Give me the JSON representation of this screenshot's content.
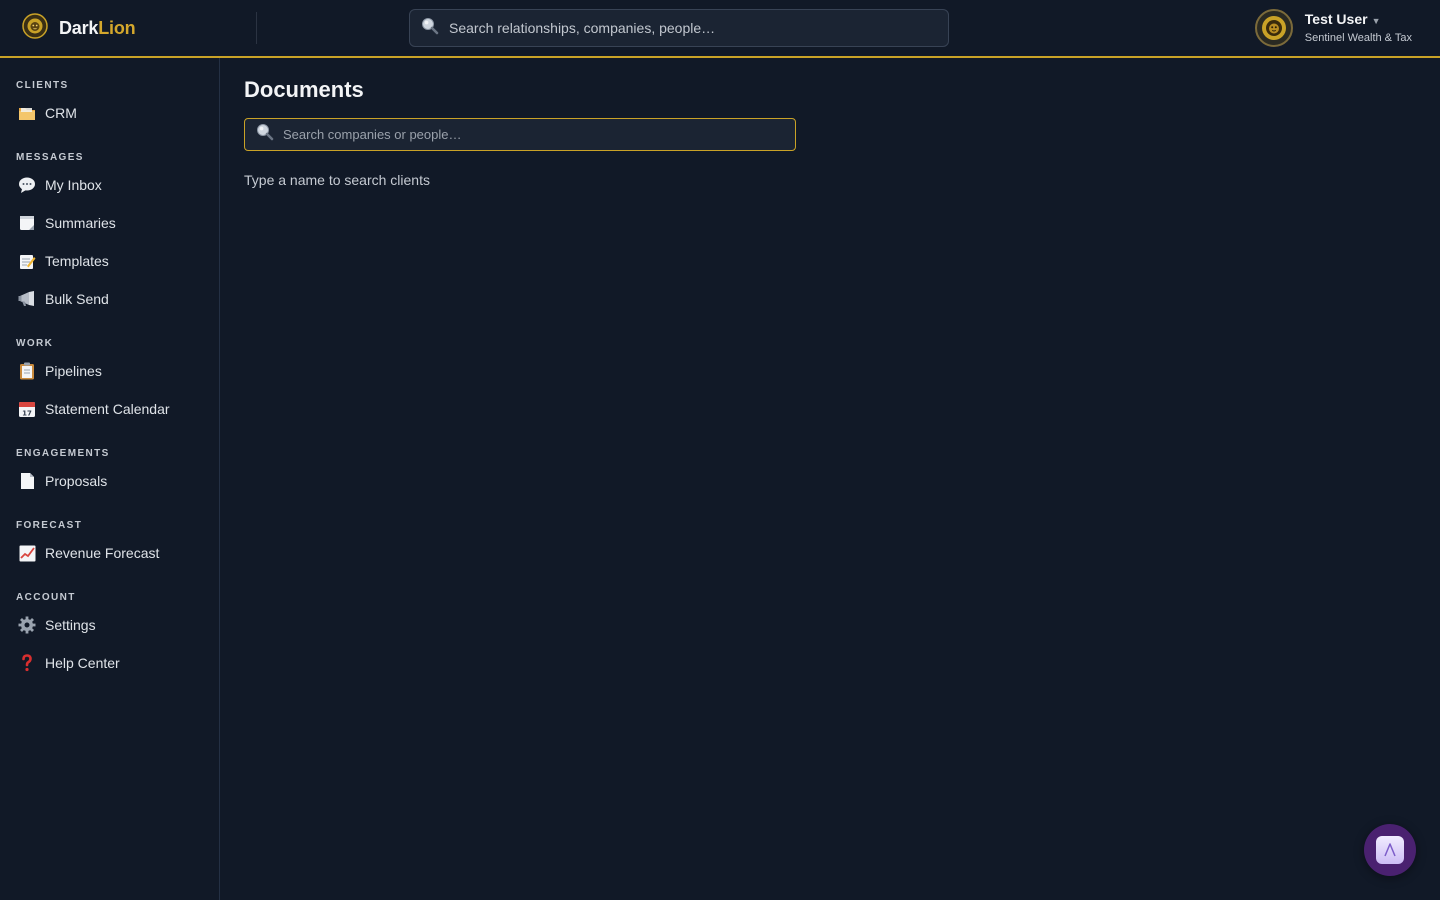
{
  "app": {
    "brand_part1": "Dark",
    "brand_part2": "Lion",
    "accent_color": "#c9a227"
  },
  "header": {
    "search_placeholder": "Search relationships, companies, people…",
    "user_name": "Test User",
    "user_caret": "▼",
    "user_org": "Sentinel Wealth & Tax"
  },
  "sidebar": {
    "sections": [
      {
        "title": "CLIENTS",
        "items": [
          {
            "label": "CRM",
            "icon": "folder-icon"
          }
        ]
      },
      {
        "title": "MESSAGES",
        "items": [
          {
            "label": "My Inbox",
            "icon": "speech-bubble-icon"
          },
          {
            "label": "Summaries",
            "icon": "notepad-icon"
          },
          {
            "label": "Templates",
            "icon": "memo-icon"
          },
          {
            "label": "Bulk Send",
            "icon": "megaphone-icon"
          }
        ]
      },
      {
        "title": "WORK",
        "items": [
          {
            "label": "Pipelines",
            "icon": "clipboard-icon"
          },
          {
            "label": "Statement Calendar",
            "icon": "calendar-icon"
          }
        ]
      },
      {
        "title": "ENGAGEMENTS",
        "items": [
          {
            "label": "Proposals",
            "icon": "document-icon"
          }
        ]
      },
      {
        "title": "FORECAST",
        "items": [
          {
            "label": "Revenue Forecast",
            "icon": "chart-up-icon"
          }
        ]
      },
      {
        "title": "ACCOUNT",
        "items": [
          {
            "label": "Settings",
            "icon": "gear-icon"
          },
          {
            "label": "Help Center",
            "icon": "question-mark-icon"
          }
        ]
      }
    ]
  },
  "main": {
    "title": "Documents",
    "search_placeholder": "Search companies or people…",
    "hint": "Type a name to search clients"
  }
}
